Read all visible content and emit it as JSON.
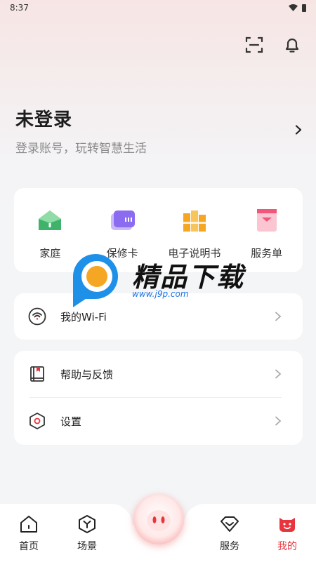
{
  "status_bar": {
    "time": "8:37"
  },
  "header": {
    "scan_icon": "scan-icon",
    "bell_icon": "bell-icon"
  },
  "user": {
    "name": "未登录",
    "subtitle": "登录账号，玩转智慧生活"
  },
  "tools": [
    {
      "label": "家庭",
      "icon": "home-icon",
      "color": "#3fb36b"
    },
    {
      "label": "保修卡",
      "icon": "warranty-card-icon",
      "color": "#8b6cf0"
    },
    {
      "label": "电子说明书",
      "icon": "manual-icon",
      "color": "#f5a623"
    },
    {
      "label": "服务单",
      "icon": "service-order-icon",
      "color": "#f0577a"
    }
  ],
  "menu": {
    "wifi": {
      "label": "我的Wi-Fi"
    },
    "help": {
      "label": "帮助与反馈"
    },
    "settings": {
      "label": "设置"
    }
  },
  "watermark": {
    "title": "精品下载",
    "url": "www.j9p.com"
  },
  "tabbar": {
    "home": "首页",
    "scene": "场景",
    "service": "服务",
    "mine": "我的"
  },
  "colors": {
    "accent": "#e8343c",
    "background": "#f4f5f7"
  }
}
